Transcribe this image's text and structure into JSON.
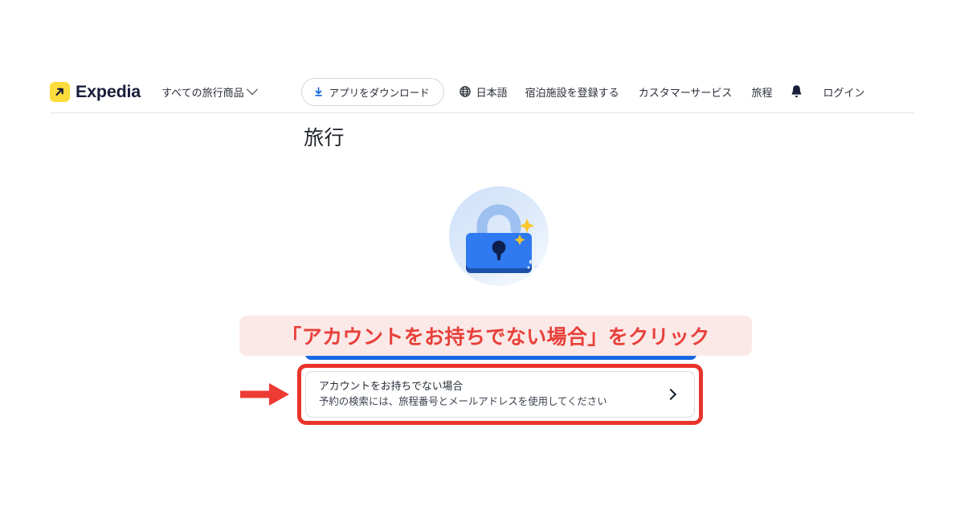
{
  "header": {
    "logo": {
      "icon": "expedia-arrow-icon",
      "wordmark": "Expedia"
    },
    "all_products": {
      "label": "すべての旅行商品",
      "icon": "chevron-down-icon"
    },
    "app_download": {
      "label": "アプリをダウンロード",
      "icon": "download-icon"
    },
    "language": {
      "label": "日本語",
      "icon": "globe-icon"
    },
    "register_property": "宿泊施設を登録する",
    "customer_service": "カスタマーサービス",
    "trips": "旅程",
    "notifications_icon": "bell-icon",
    "login": "ログイン"
  },
  "main": {
    "page_title": "旅行",
    "illustration": {
      "name": "unlocked-padlock-illustration",
      "sparkles": "sparkles-icon"
    },
    "primary_button": {
      "label": ""
    },
    "guest_card": {
      "title": "アカウントをお持ちでない場合",
      "subtitle": "予約の検索には、旅程番号とメールアドレスを使用してください",
      "chevron": "chevron-right-icon"
    }
  },
  "annotations": {
    "banner_text": "「アカウントをお持ちでない場合」をクリック",
    "arrow": "red-arrow-icon",
    "highlight_box": "red-highlight-rectangle"
  },
  "colors": {
    "brand_yellow": "#fcdc3b",
    "brand_navy": "#191e3b",
    "brand_blue": "#1668e3",
    "annotation_red": "#e8342b",
    "annotation_banner_bg": "#fbe9e8",
    "annotation_text_red": "#e8403a"
  }
}
